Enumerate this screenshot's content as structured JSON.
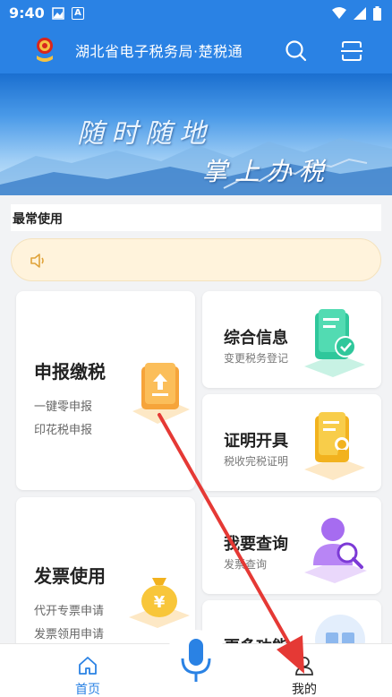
{
  "status_bar": {
    "time": "9:40",
    "icons": [
      "image-icon",
      "font-a-icon",
      "wifi-icon",
      "signal-icon",
      "battery-icon"
    ],
    "font_badge": "A"
  },
  "header": {
    "title": "湖北省电子税务局·楚税通",
    "icons": [
      "emblem-logo",
      "search-icon",
      "scan-icon"
    ],
    "background": "#2a82e4"
  },
  "banner": {
    "line1": "随时随地",
    "line2": "掌上办税"
  },
  "section": {
    "title": "最常使用"
  },
  "notice": {
    "icon": "speaker-icon",
    "background": "#fff3dc"
  },
  "cards": {
    "declare": {
      "title": "申报缴税",
      "items": [
        "一键零申报",
        "印花税申报"
      ],
      "icon": "upload-folder-icon"
    },
    "info": {
      "title": "综合信息",
      "subtitle": "变更税务登记",
      "icon": "document-check-icon"
    },
    "certificate": {
      "title": "证明开具",
      "subtitle": "税收完税证明",
      "icon": "certificate-icon"
    },
    "invoice": {
      "title": "发票使用",
      "items": [
        "代开专票申请",
        "发票领用申请"
      ],
      "icon": "money-bag-icon"
    },
    "query": {
      "title": "我要查询",
      "subtitle": "发票查询",
      "icon": "user-search-icon"
    },
    "more": {
      "title": "更多功能",
      "icon": "grid-icon"
    }
  },
  "bottom_nav": {
    "home_label": "首页",
    "mine_label": "我的",
    "accent": "#2a82e4"
  },
  "annotation": {
    "arrow_color": "#e53935"
  }
}
